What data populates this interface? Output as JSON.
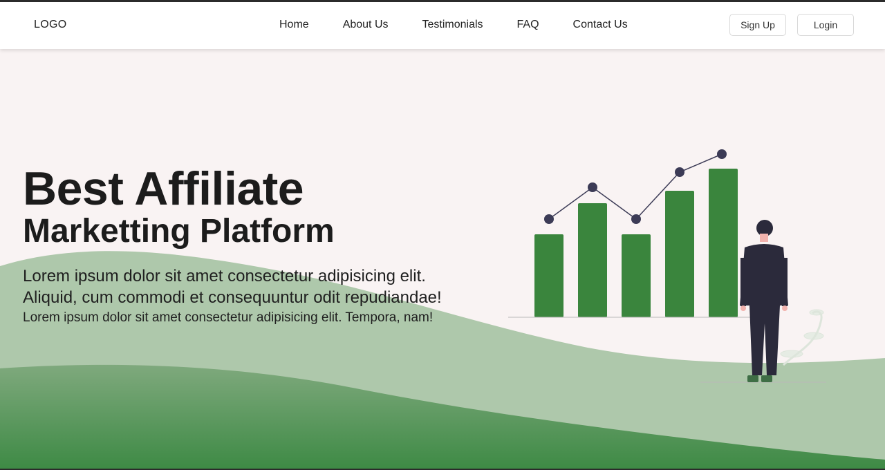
{
  "nav": {
    "logo": "LOGO",
    "links": [
      "Home",
      "About Us",
      "Testimonials",
      "FAQ",
      "Contact Us"
    ],
    "signup_label": "Sign Up",
    "login_label": "Login"
  },
  "hero": {
    "title": "Best Affiliate",
    "subtitle": "Marketting Platform",
    "lead": "Lorem ipsum dolor sit amet consectetur adipisicing elit. Aliquid, cum commodi et consequuntur odit repudiandae!",
    "body": "Lorem ipsum dolor sit amet consectetur adipisicing elit. Tempora, nam!"
  },
  "colors": {
    "background": "#f9f3f3",
    "bar_green": "#3a853d",
    "wave_light": "#aec8ab",
    "wave_dark": "#3e8a45",
    "point": "#3c3b56",
    "figure": "#2b2a3b"
  },
  "illustration": {
    "bar_values": [
      120,
      165,
      120,
      183,
      215
    ],
    "point_values": [
      142,
      188,
      142,
      210,
      236
    ]
  }
}
